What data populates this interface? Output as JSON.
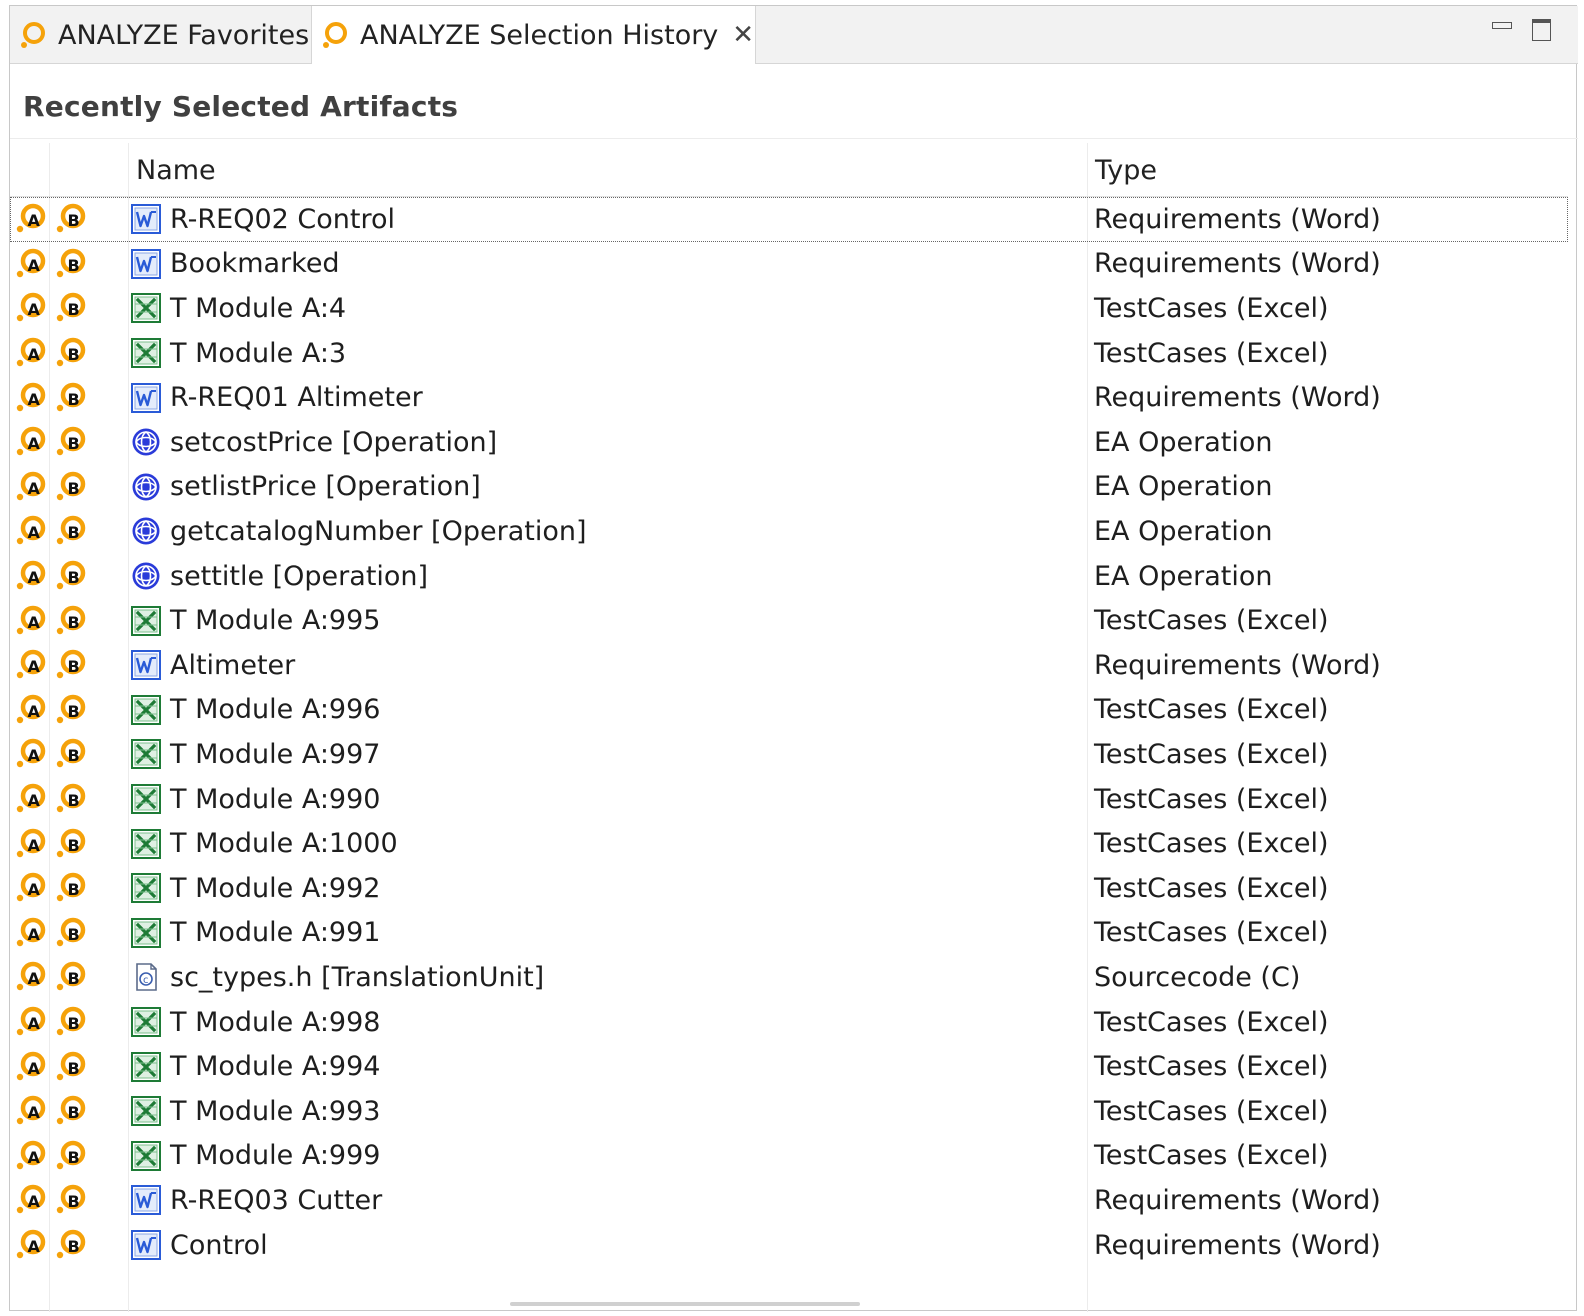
{
  "tabs": [
    {
      "label": "ANALYZE Favorites",
      "active": false
    },
    {
      "label": "ANALYZE Selection History",
      "active": true,
      "close": "✕"
    }
  ],
  "section_title": "Recently Selected Artifacts",
  "columns": {
    "name": "Name",
    "type": "Type"
  },
  "marker_icons": {
    "a": "A",
    "b": "B"
  },
  "colors": {
    "accent_orange": "#f5a20a",
    "word_blue": "#2a5bd7",
    "excel_green": "#1e7b36",
    "ea_blue": "#2a3bd9"
  },
  "rows": [
    {
      "name": "R-REQ02 Control",
      "type": "Requirements (Word)",
      "icon": "word",
      "selected": true
    },
    {
      "name": "Bookmarked",
      "type": "Requirements (Word)",
      "icon": "word"
    },
    {
      "name": "T Module A:4",
      "type": "TestCases (Excel)",
      "icon": "excel"
    },
    {
      "name": "T Module A:3",
      "type": "TestCases (Excel)",
      "icon": "excel"
    },
    {
      "name": "R-REQ01 Altimeter",
      "type": "Requirements (Word)",
      "icon": "word"
    },
    {
      "name": "setcostPrice [Operation]",
      "type": "EA Operation",
      "icon": "ea"
    },
    {
      "name": "setlistPrice [Operation]",
      "type": "EA Operation",
      "icon": "ea"
    },
    {
      "name": "getcatalogNumber [Operation]",
      "type": "EA Operation",
      "icon": "ea"
    },
    {
      "name": "settitle [Operation]",
      "type": "EA Operation",
      "icon": "ea"
    },
    {
      "name": "T Module A:995",
      "type": "TestCases (Excel)",
      "icon": "excel"
    },
    {
      "name": "Altimeter",
      "type": "Requirements (Word)",
      "icon": "word"
    },
    {
      "name": "T Module A:996",
      "type": "TestCases (Excel)",
      "icon": "excel"
    },
    {
      "name": "T Module A:997",
      "type": "TestCases (Excel)",
      "icon": "excel"
    },
    {
      "name": "T Module A:990",
      "type": "TestCases (Excel)",
      "icon": "excel"
    },
    {
      "name": "T Module A:1000",
      "type": "TestCases (Excel)",
      "icon": "excel"
    },
    {
      "name": "T Module A:992",
      "type": "TestCases (Excel)",
      "icon": "excel"
    },
    {
      "name": "T Module A:991",
      "type": "TestCases (Excel)",
      "icon": "excel"
    },
    {
      "name": "sc_types.h [TranslationUnit]",
      "type": "Sourcecode (C)",
      "icon": "c-source"
    },
    {
      "name": "T Module A:998",
      "type": "TestCases (Excel)",
      "icon": "excel"
    },
    {
      "name": "T Module A:994",
      "type": "TestCases (Excel)",
      "icon": "excel"
    },
    {
      "name": "T Module A:993",
      "type": "TestCases (Excel)",
      "icon": "excel"
    },
    {
      "name": "T Module A:999",
      "type": "TestCases (Excel)",
      "icon": "excel"
    },
    {
      "name": "R-REQ03 Cutter",
      "type": "Requirements (Word)",
      "icon": "word"
    },
    {
      "name": "Control",
      "type": "Requirements (Word)",
      "icon": "word"
    }
  ]
}
